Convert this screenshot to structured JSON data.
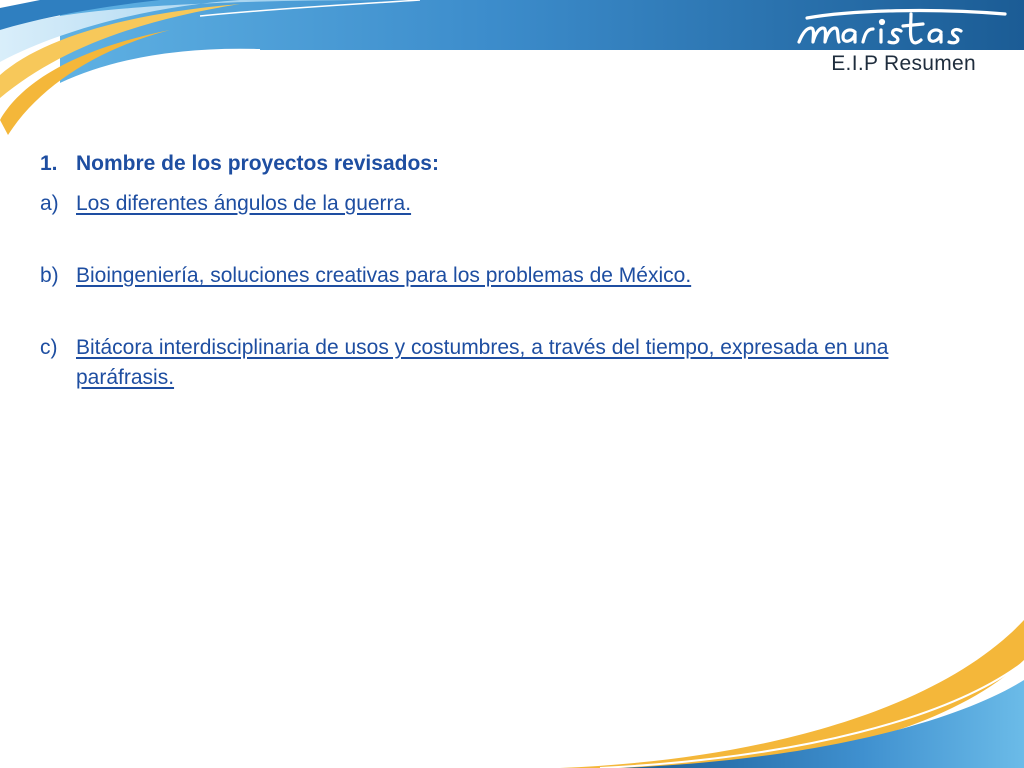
{
  "slide": {
    "brand": "maristas",
    "subtitle": "E.I.P  Resumen",
    "heading": {
      "marker": "1.",
      "text": "Nombre de los  proyectos revisados:"
    },
    "items": [
      {
        "marker": "a)",
        "text": "Los diferentes ángulos de la guerra."
      },
      {
        "marker": "b)",
        "text": "Bioingeniería, soluciones creativas para los problemas de México."
      },
      {
        "marker": "c)",
        "text": "Bitácora interdisciplinaria de usos y costumbres, a través del tiempo, expresada en una paráfrasis."
      }
    ]
  },
  "colors": {
    "band_dark": "#1d5e97",
    "band_light": "#4a9fd6",
    "accent_yellow": "#f4b73a",
    "text_blue": "#1e4ea1"
  }
}
